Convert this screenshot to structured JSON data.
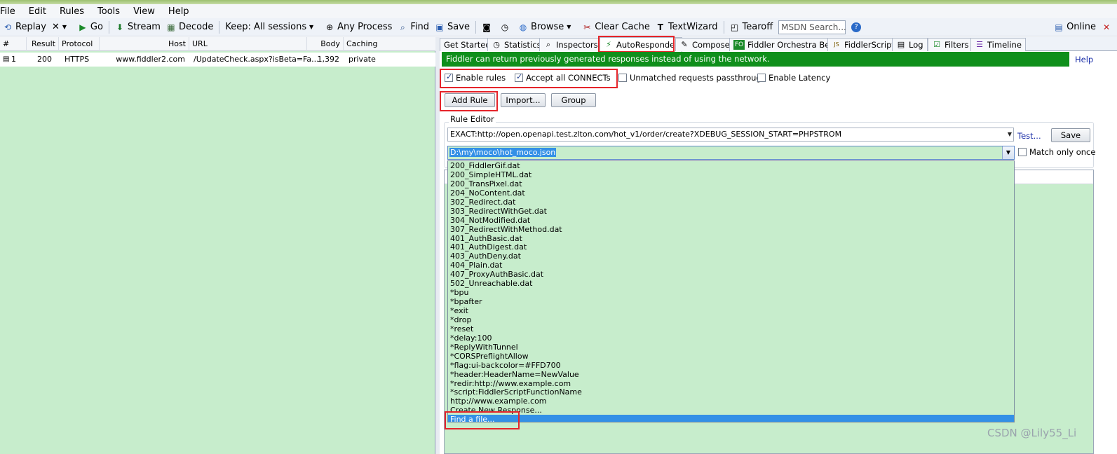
{
  "menu": [
    "File",
    "Edit",
    "Rules",
    "Tools",
    "View",
    "Help"
  ],
  "toolbar": {
    "replay": "Replay",
    "remove": "✕",
    "go": "Go",
    "stream": "Stream",
    "decode": "Decode",
    "keep": "Keep: All sessions",
    "any_process": "Any Process",
    "find": "Find",
    "save": "Save",
    "browse": "Browse",
    "clear_cache": "Clear Cache",
    "textwizard": "TextWizard",
    "tearoff": "Tearoff",
    "msdn_placeholder": "MSDN Search...",
    "online": "Online"
  },
  "sessions": {
    "columns": [
      "#",
      "Result",
      "Protocol",
      "Host",
      "URL",
      "Body",
      "Caching"
    ],
    "rows": [
      {
        "num": "1",
        "result": "200",
        "protocol": "HTTPS",
        "host": "www.fiddler2.com",
        "url": "/UpdateCheck.aspx?isBeta=Fa...",
        "body": "1,392",
        "caching": "private"
      }
    ]
  },
  "tabs": [
    "Get Started",
    "Statistics",
    "Inspectors",
    "AutoResponder",
    "Composer",
    "Fiddler Orchestra Beta",
    "FiddlerScript",
    "Log",
    "Filters",
    "Timeline"
  ],
  "fo_badge": "FO",
  "js_badge": "JS",
  "autoresponder": {
    "banner": "Fiddler can return previously generated responses instead of using the network.",
    "help": "Help",
    "enable_rules": "Enable rules",
    "accept_connects": "Accept all CONNECTs",
    "unmatched_passthrough": "Unmatched requests passthrough",
    "enable_latency": "Enable Latency",
    "add_rule": "Add Rule",
    "import": "Import...",
    "group": "Group",
    "rule_editor": "Rule Editor",
    "match_value": "EXACT:http://open.openapi.test.zlton.com/hot_v1/order/create?XDEBUG_SESSION_START=PHPSTROM",
    "test": "Test...",
    "save": "Save",
    "action_value": "D:\\my\\moco\\hot_moco.json",
    "match_only_once": "Match only once",
    "options": [
      "200_FiddlerGif.dat",
      "200_SimpleHTML.dat",
      "200_TransPixel.dat",
      "204_NoContent.dat",
      "302_Redirect.dat",
      "303_RedirectWithGet.dat",
      "304_NotModified.dat",
      "307_RedirectWithMethod.dat",
      "401_AuthBasic.dat",
      "401_AuthDigest.dat",
      "403_AuthDeny.dat",
      "404_Plain.dat",
      "407_ProxyAuthBasic.dat",
      "502_Unreachable.dat",
      "*bpu",
      "*bpafter",
      "*exit",
      "*drop",
      "*reset",
      "*delay:100",
      "*ReplyWithTunnel",
      "*CORSPreflightAllow",
      "*flag:ui-backcolor=#FFD700",
      "*header:HeaderName=NewValue",
      "*redir:http://www.example.com",
      "*script:FiddlerScriptFunctionName",
      "http://www.example.com",
      "Create New Response...",
      "Find a file..."
    ],
    "highlighted_option": "Find a file..."
  },
  "watermark": "CSDN @Lily55_Li",
  "colors": {
    "banner_green": "#0f8f1b",
    "pane_green": "#c7edcc",
    "highlight_blue": "#3390e6",
    "annotation_red": "#e5242a",
    "link_blue": "#1a2ea8"
  }
}
